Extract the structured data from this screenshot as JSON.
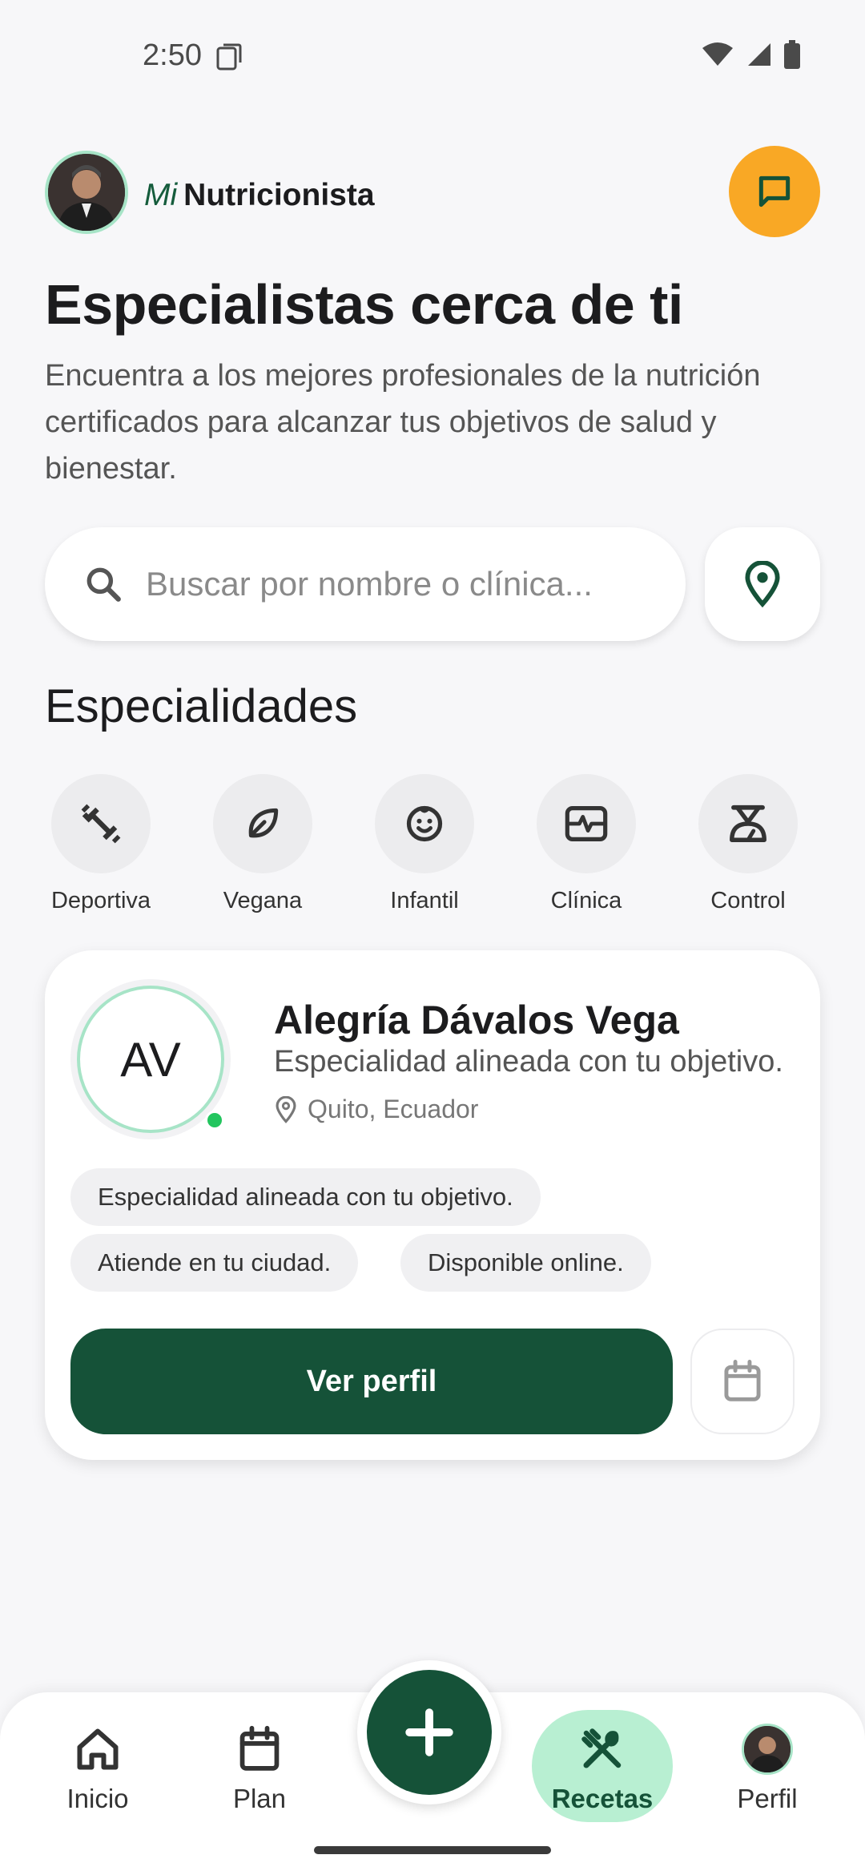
{
  "status_bar": {
    "time": "2:50"
  },
  "header": {
    "brand_prefix": "Mi",
    "brand_name": "Nutricionista"
  },
  "hero": {
    "title": "Especialistas cerca de ti",
    "subtitle": "Encuentra a los mejores profesionales de la nutrición certificados para alcanzar tus objetivos de salud y bienestar."
  },
  "search": {
    "placeholder": "Buscar por nombre o clínica..."
  },
  "specialties": {
    "title": "Especialidades",
    "items": [
      {
        "label": "Deportiva",
        "icon": "dumbbell-icon"
      },
      {
        "label": "Vegana",
        "icon": "leaf-icon"
      },
      {
        "label": "Infantil",
        "icon": "baby-face-icon"
      },
      {
        "label": "Clínica",
        "icon": "monitor-heart-icon"
      },
      {
        "label": "Control",
        "icon": "scale-icon"
      }
    ]
  },
  "card": {
    "initials": "AV",
    "name": "Alegría Dávalos Vega",
    "specialty": "Especialidad alineada con tu objetivo.",
    "location": "Quito, Ecuador",
    "chips": [
      "Especialidad alineada con tu objetivo.",
      "Atiende en tu ciudad.",
      "Disponible online."
    ],
    "primary_action": "Ver perfil"
  },
  "bottom_nav": {
    "items": [
      {
        "label": "Inicio",
        "icon": "home-icon"
      },
      {
        "label": "Plan",
        "icon": "calendar-icon"
      },
      {
        "label": "Recetas",
        "icon": "utensils-icon",
        "active": true
      },
      {
        "label": "Perfil",
        "icon": "avatar"
      }
    ]
  },
  "colors": {
    "primary": "#155238",
    "accent": "#f9a825",
    "active_pill": "#b8efd2",
    "online": "#22c55e"
  }
}
